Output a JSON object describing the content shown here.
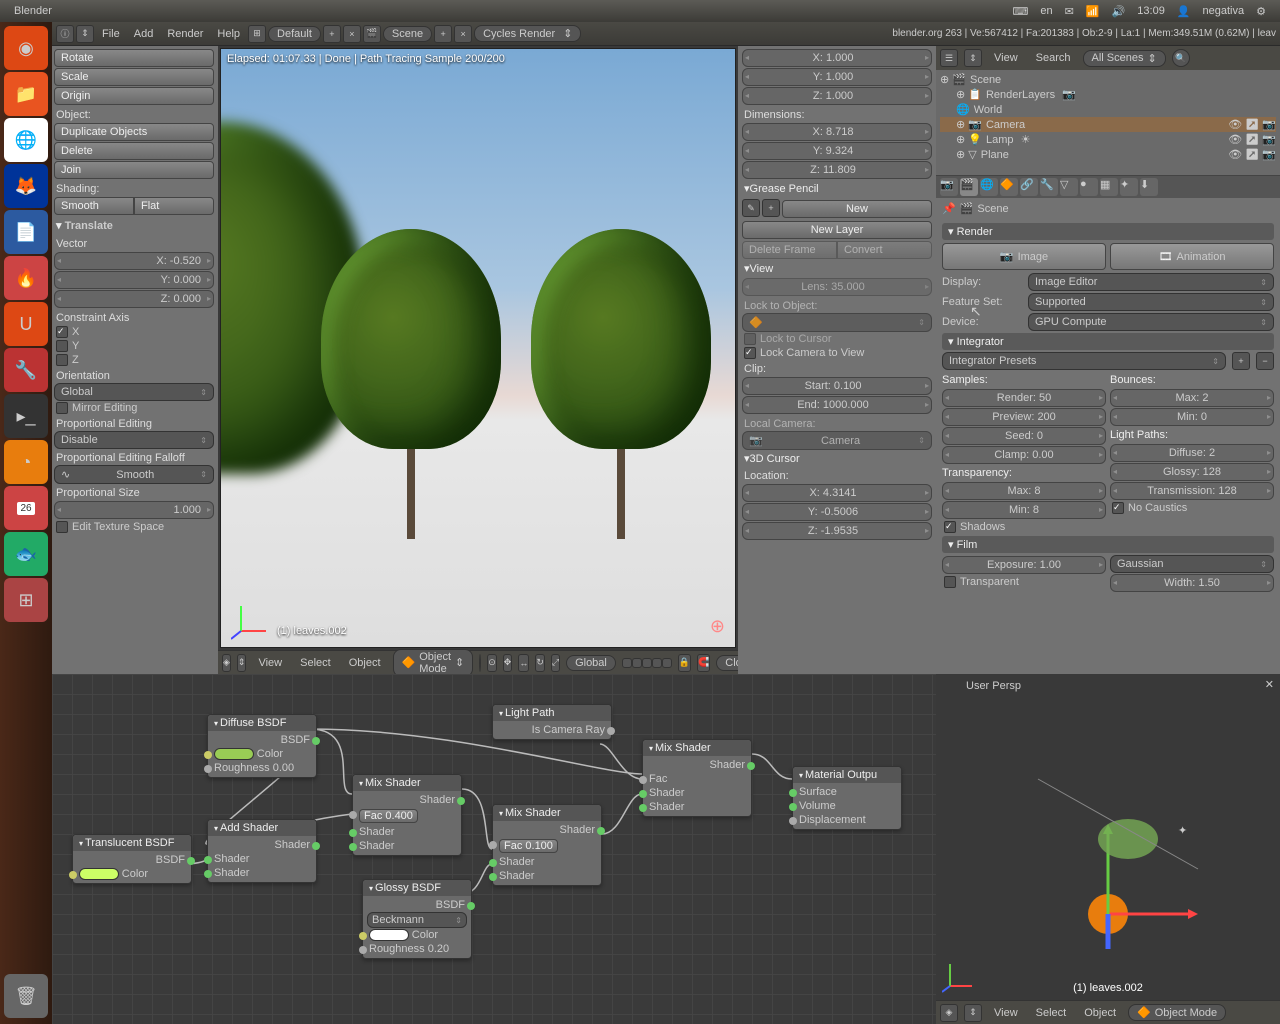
{
  "titlebar": {
    "app": "Blender",
    "lang": "en",
    "time": "13:09",
    "user": "negativa"
  },
  "topmenu": {
    "items": [
      "File",
      "Add",
      "Render",
      "Help"
    ],
    "layout": "Default",
    "scene": "Scene",
    "engine": "Cycles Render",
    "status": "blender.org 263 | Ve:567412 | Fa:201383 | Ob:2-9 | La:1 | Mem:349.51M (0.62M) | leav"
  },
  "toolpanel": {
    "rotate": "Rotate",
    "scale": "Scale",
    "origin": "Origin",
    "object_hdr": "Object:",
    "dup": "Duplicate Objects",
    "delete": "Delete",
    "join": "Join",
    "shading_hdr": "Shading:",
    "smooth": "Smooth",
    "flat": "Flat",
    "translate": "Translate",
    "vector": "Vector",
    "x": "X: -0.520",
    "y": "Y: 0.000",
    "z": "Z: 0.000",
    "constraint": "Constraint Axis",
    "cx": "X",
    "cy": "Y",
    "cz": "Z",
    "orientation": "Orientation",
    "global": "Global",
    "mirror": "Mirror Editing",
    "propedit": "Proportional Editing",
    "disable": "Disable",
    "falloff": "Proportional Editing Falloff",
    "smooth2": "Smooth",
    "propsize": "Proportional Size",
    "propsize_v": "1.000",
    "edittex": "Edit Texture Space"
  },
  "render": {
    "status": "Elapsed: 01:07.33 | Done | Path Tracing Sample 200/200",
    "objlabel": "(1) leaves.002"
  },
  "vpbar": {
    "view": "View",
    "select": "Select",
    "object": "Object",
    "mode": "Object Mode",
    "global": "Global",
    "closest": "Closest"
  },
  "npanel": {
    "x": "X: 1.000",
    "y": "Y: 1.000",
    "z": "Z: 1.000",
    "dim": "Dimensions:",
    "dx": "X: 8.718",
    "dy": "Y: 9.324",
    "dz": "Z: 11.809",
    "grease": "Grease Pencil",
    "new": "New",
    "newlayer": "New Layer",
    "delframe": "Delete Frame",
    "convert": "Convert",
    "viewh": "View",
    "lens": "Lens: 35.000",
    "locktoobj": "Lock to Object:",
    "lockcursor": "Lock to Cursor",
    "lockcam": "Lock Camera to View",
    "clip": "Clip:",
    "start": "Start: 0.100",
    "end": "End: 1000.000",
    "localcam": "Local Camera:",
    "camera": "Camera",
    "cursor3d": "3D Cursor",
    "location": "Location:",
    "cx": "X: 4.3141",
    "cy": "Y: -0.5006",
    "cz": "Z: -1.9535"
  },
  "outliner": {
    "view": "View",
    "search": "Search",
    "filter": "All Scenes",
    "items": [
      "Scene",
      "RenderLayers",
      "World",
      "Camera",
      "Lamp",
      "Plane"
    ]
  },
  "scenelabel": "Scene",
  "props": {
    "render_hdr": "Render",
    "image": "Image",
    "animation": "Animation",
    "display": "Display:",
    "display_v": "Image Editor",
    "featureset": "Feature Set:",
    "featureset_v": "Supported",
    "device": "Device:",
    "device_v": "GPU Compute",
    "integrator": "Integrator",
    "presets": "Integrator Presets",
    "samples": "Samples:",
    "bounces": "Bounces:",
    "render_s": "Render: 50",
    "max_b": "Max: 2",
    "preview_s": "Preview: 200",
    "min_b": "Min: 0",
    "seed": "Seed: 0",
    "lightpaths": "Light Paths:",
    "clamp": "Clamp: 0.00",
    "diffuse": "Diffuse: 2",
    "transparency": "Transparency:",
    "glossy": "Glossy: 128",
    "max_t": "Max: 8",
    "transmission": "Transmission: 128",
    "min_t": "Min: 8",
    "nocaustics": "No Caustics",
    "shadows": "Shadows",
    "film": "Film",
    "exposure": "Exposure: 1.00",
    "filter": "Gaussian",
    "transparent": "Transparent",
    "width": "Width: 1.50"
  },
  "nodes": {
    "diffuse": {
      "title": "Diffuse BSDF",
      "out": "BSDF",
      "color": "Color",
      "rough": "Roughness 0.00"
    },
    "translucent": {
      "title": "Translucent BSDF",
      "out": "BSDF",
      "color": "Color"
    },
    "add": {
      "title": "Add Shader",
      "out": "Shader",
      "s1": "Shader",
      "s2": "Shader"
    },
    "mix1": {
      "title": "Mix Shader",
      "out": "Shader",
      "fac": "Fac 0.400",
      "s1": "Shader",
      "s2": "Shader"
    },
    "glossy": {
      "title": "Glossy BSDF",
      "out": "BSDF",
      "dist": "Beckmann",
      "color": "Color",
      "rough": "Roughness 0.20"
    },
    "mix2": {
      "title": "Mix Shader",
      "out": "Shader",
      "fac": "Fac 0.100",
      "s1": "Shader",
      "s2": "Shader"
    },
    "lightpath": {
      "title": "Light Path",
      "out": "Is Camera Ray"
    },
    "mix3": {
      "title": "Mix Shader",
      "out": "Shader",
      "fac": "Fac",
      "s1": "Shader",
      "s2": "Shader"
    },
    "output": {
      "title": "Material Outpu",
      "surface": "Surface",
      "volume": "Volume",
      "disp": "Displacement"
    }
  },
  "minivp": {
    "persp": "User Persp",
    "obj": "(1) leaves.002",
    "view": "View",
    "select": "Select",
    "object": "Object",
    "mode": "Object Mode"
  }
}
